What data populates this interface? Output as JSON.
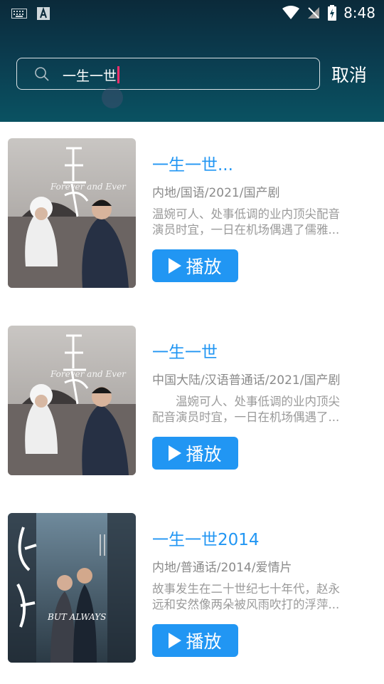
{
  "status_bar": {
    "time": "8:48"
  },
  "search": {
    "query": "一生一世",
    "cancel_label": "取消"
  },
  "results": [
    {
      "title": "一生一世...",
      "meta": "内地/国语/2021/国产剧",
      "desc_line1": "温婉可人、处事低调的业内顶尖配音",
      "desc_line2": "演员时宜，一日在机场偶遇了儒雅...",
      "play_label": "播放",
      "poster_text": "Forever and Ever"
    },
    {
      "title": "一生一世",
      "meta": "中国大陆/汉语普通话/2021/国产剧",
      "desc_line1": "　　温婉可人、处事低调的业内顶尖",
      "desc_line2": "配音演员时宜，一日在机场偶遇了...",
      "play_label": "播放",
      "poster_text": "Forever and Ever"
    },
    {
      "title": "一生一世2014",
      "meta": "内地/普通话/2014/爱情片",
      "desc_line1": "故事发生在二十世纪七十年代，赵永",
      "desc_line2": "远和安然像两朵被风雨吹打的浮萍...",
      "play_label": "播放",
      "poster_text": "BUT ALWAYS"
    }
  ],
  "colors": {
    "accent": "#2196f3",
    "header_top": "#0b2a3a",
    "header_bottom": "#0a5262",
    "caret": "#ff2d6b"
  }
}
